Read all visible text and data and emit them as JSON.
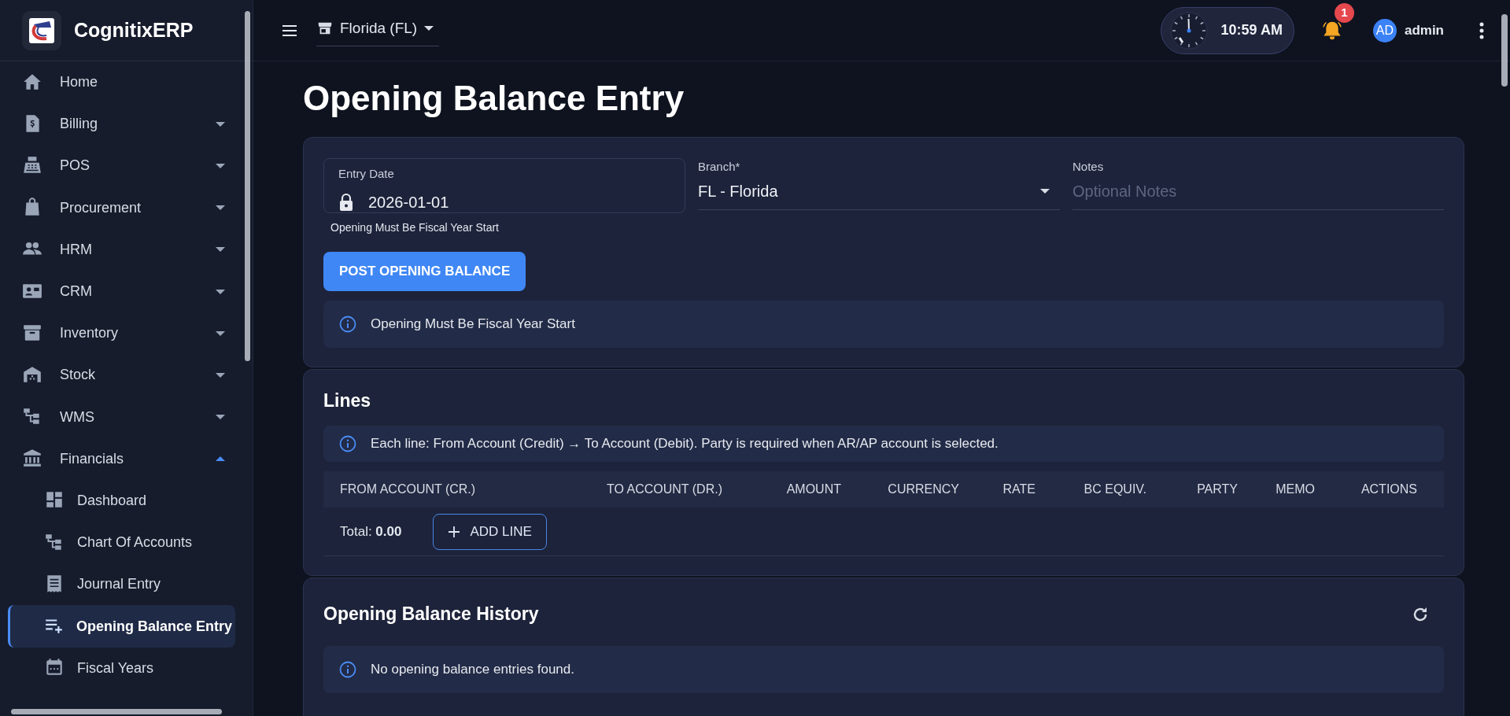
{
  "app": {
    "name": "CognitixERP"
  },
  "sidebar": {
    "items": [
      {
        "label": "Home",
        "kind": "link"
      },
      {
        "label": "Billing",
        "kind": "group",
        "expanded": false
      },
      {
        "label": "POS",
        "kind": "group",
        "expanded": false
      },
      {
        "label": "Procurement",
        "kind": "group",
        "expanded": false
      },
      {
        "label": "HRM",
        "kind": "group",
        "expanded": false
      },
      {
        "label": "CRM",
        "kind": "group",
        "expanded": false
      },
      {
        "label": "Inventory",
        "kind": "group",
        "expanded": false
      },
      {
        "label": "Stock",
        "kind": "group",
        "expanded": false
      },
      {
        "label": "WMS",
        "kind": "group",
        "expanded": false
      },
      {
        "label": "Financials",
        "kind": "group",
        "expanded": true,
        "children": [
          {
            "label": "Dashboard",
            "selected": false
          },
          {
            "label": "Chart Of Accounts",
            "selected": false
          },
          {
            "label": "Journal Entry",
            "selected": false
          },
          {
            "label": "Opening Balance Entry",
            "selected": true
          },
          {
            "label": "Fiscal Years",
            "selected": false
          }
        ]
      }
    ]
  },
  "top_bar": {
    "branch": "Florida (FL)",
    "time": "10:59 AM",
    "notifications": "1",
    "user": {
      "initials": "AD",
      "name": "admin"
    }
  },
  "page_title": "Opening Balance Entry",
  "entry_form": {
    "entry_date": {
      "label": "Entry Date",
      "value": "2026-01-01",
      "locked": true,
      "helper": "Opening Must Be Fiscal Year Start"
    },
    "branch": {
      "label": "Branch*",
      "value": "FL - Florida"
    },
    "notes": {
      "label": "Notes",
      "placeholder": "Optional Notes"
    },
    "submit": "POST OPENING BALANCE",
    "info": "Opening Must Be Fiscal Year Start"
  },
  "lines": {
    "title": "Lines",
    "info": "Each line: From Account (Credit) → To Account (Debit). Party is required when AR/AP account is selected.",
    "table": {
      "columns": [
        "FROM ACCOUNT (CR.)",
        "TO ACCOUNT (DR.)",
        "AMOUNT",
        "CURRENCY",
        "RATE",
        "BC EQUIV.",
        "PARTY",
        "MEMO",
        "ACTIONS"
      ]
    },
    "total": "Total: **0.00**",
    "add_button": "ADD LINE"
  },
  "history": {
    "title": "Opening Balance History",
    "info": "No opening balance entries found."
  }
}
